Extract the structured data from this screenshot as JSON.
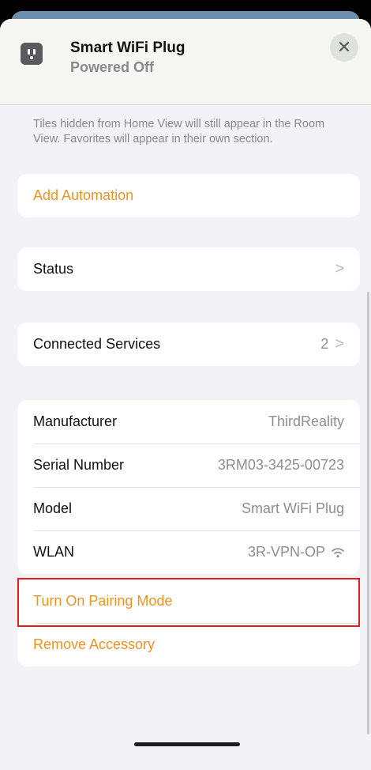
{
  "header": {
    "title": "Smart WiFi Plug",
    "subtitle": "Powered Off",
    "icon": "power-outlet-icon",
    "close_label": "✕"
  },
  "note": "Tiles hidden from Home View will still appear in the Room View. Favorites will appear in their own section.",
  "automation": {
    "label": "Add Automation"
  },
  "status": {
    "label": "Status"
  },
  "connected_services": {
    "label": "Connected Services",
    "count": "2"
  },
  "info": {
    "manufacturer": {
      "label": "Manufacturer",
      "value": "ThirdReality"
    },
    "serial": {
      "label": "Serial Number",
      "value": "3RM03-3425-00723"
    },
    "model": {
      "label": "Model",
      "value": "Smart WiFi Plug"
    },
    "wlan": {
      "label": "WLAN",
      "value": "3R-VPN-OP"
    }
  },
  "actions": {
    "pairing": "Turn On Pairing Mode",
    "remove": "Remove Accessory"
  },
  "colors": {
    "accent": "#e99424",
    "highlight": "#e31b23",
    "background": "#f2f2f7"
  }
}
